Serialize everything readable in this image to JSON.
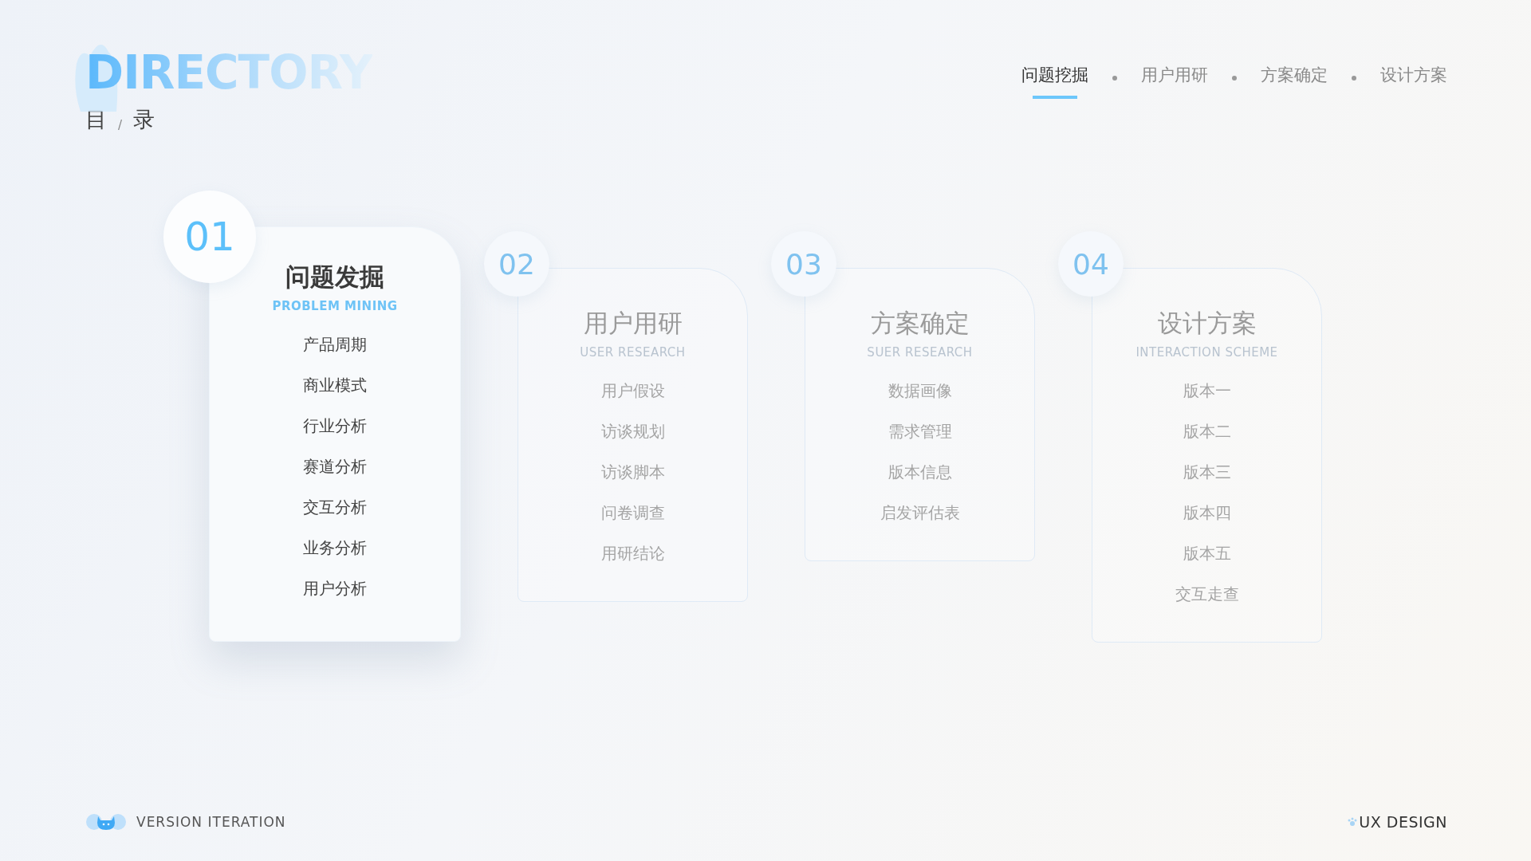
{
  "header": {
    "title": "DIRECTORY",
    "subtitle_left": "目",
    "separator": "/",
    "subtitle_right": "录"
  },
  "nav": [
    {
      "label": "问题挖掘",
      "selected": true
    },
    {
      "label": "用户用研",
      "selected": false
    },
    {
      "label": "方案确定",
      "selected": false
    },
    {
      "label": "设计方案",
      "selected": false
    }
  ],
  "cards": [
    {
      "number": "01",
      "title": "问题发掘",
      "subtitle": "PROBLEM MINING",
      "selected": true,
      "items": [
        "产品周期",
        "商业模式",
        "行业分析",
        "赛道分析",
        "交互分析",
        "业务分析",
        "用户分析"
      ]
    },
    {
      "number": "02",
      "title": "用户用研",
      "subtitle": "USER RESEARCH",
      "selected": false,
      "items": [
        "用户假设",
        "访谈规划",
        "访谈脚本",
        "问卷调查",
        "用研结论"
      ]
    },
    {
      "number": "03",
      "title": "方案确定",
      "subtitle": "SUER RESEARCH",
      "selected": false,
      "items": [
        "数据画像",
        "需求管理",
        "版本信息",
        "启发评估表"
      ]
    },
    {
      "number": "04",
      "title": "设计方案",
      "subtitle": "INTERACTION SCHEME",
      "selected": false,
      "items": [
        "版本一",
        "版本二",
        "版本三",
        "版本四",
        "版本五",
        "交互走查"
      ]
    }
  ],
  "footer": {
    "left": "VERSION ITERATION",
    "right": "UX DESIGN"
  }
}
